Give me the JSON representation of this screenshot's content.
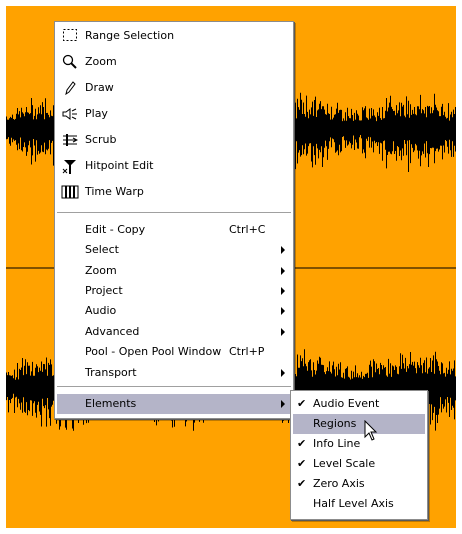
{
  "colors": {
    "background": "#ffa200",
    "waveform": "#000000",
    "menu_bg": "#ffffff",
    "selection": "#b4b4c8"
  },
  "tools": [
    {
      "label": "Range Selection",
      "icon": "range-selection-icon"
    },
    {
      "label": "Zoom",
      "icon": "magnifier-icon"
    },
    {
      "label": "Draw",
      "icon": "pencil-icon"
    },
    {
      "label": "Play",
      "icon": "speaker-icon"
    },
    {
      "label": "Scrub",
      "icon": "scrub-icon"
    },
    {
      "label": "Hitpoint Edit",
      "icon": "hitpoint-icon"
    },
    {
      "label": "Time Warp",
      "icon": "time-warp-icon"
    }
  ],
  "commands": [
    {
      "label": "Edit - Copy",
      "shortcut": "Ctrl+C",
      "submenu": false
    },
    {
      "label": "Select",
      "shortcut": "",
      "submenu": true
    },
    {
      "label": "Zoom",
      "shortcut": "",
      "submenu": true
    },
    {
      "label": "Project",
      "shortcut": "",
      "submenu": true
    },
    {
      "label": "Audio",
      "shortcut": "",
      "submenu": true
    },
    {
      "label": "Advanced",
      "shortcut": "",
      "submenu": true
    },
    {
      "label": "Pool - Open Pool Window",
      "shortcut": "Ctrl+P",
      "submenu": false
    },
    {
      "label": "Transport",
      "shortcut": "",
      "submenu": true
    }
  ],
  "elements_item": {
    "label": "Elements",
    "submenu": true,
    "selected": true
  },
  "elements_submenu": [
    {
      "label": "Audio Event",
      "checked": true,
      "highlighted": false
    },
    {
      "label": "Regions",
      "checked": false,
      "highlighted": true
    },
    {
      "label": "Info Line",
      "checked": true,
      "highlighted": false
    },
    {
      "label": "Level Scale",
      "checked": true,
      "highlighted": false
    },
    {
      "label": "Zero Axis",
      "checked": true,
      "highlighted": false
    },
    {
      "label": "Half Level Axis",
      "checked": false,
      "highlighted": false
    }
  ]
}
